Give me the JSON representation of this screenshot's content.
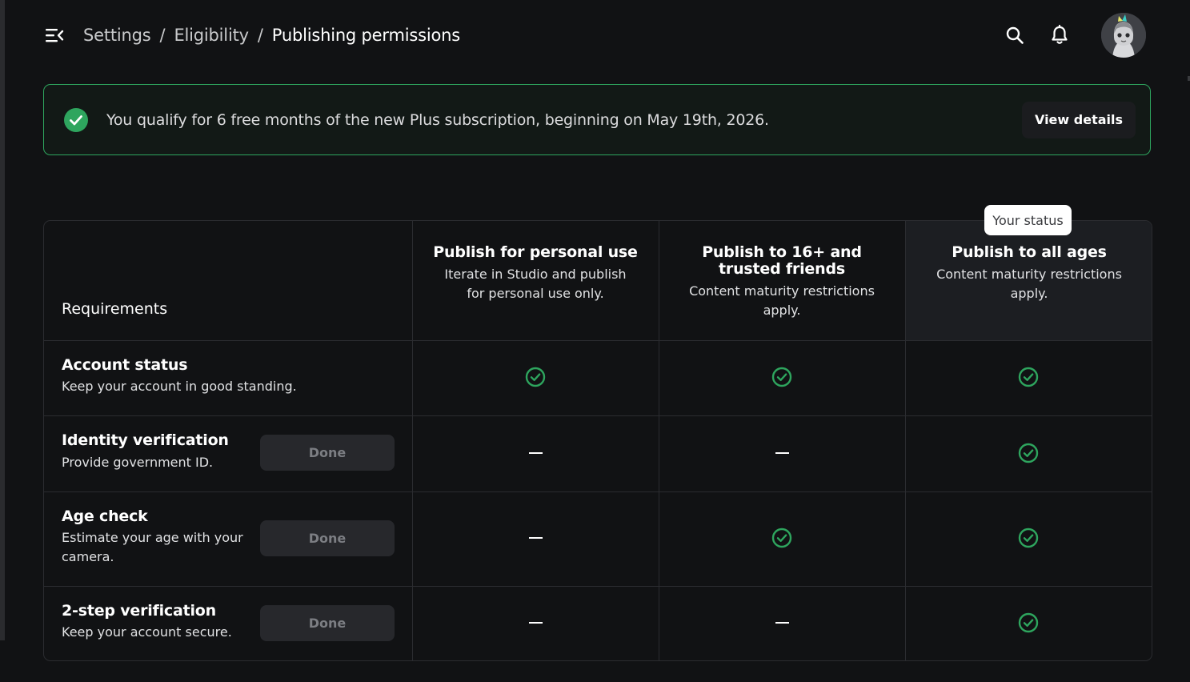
{
  "header": {
    "breadcrumb": [
      "Settings",
      "Eligibility",
      "Publishing permissions"
    ],
    "separator": "/"
  },
  "banner": {
    "message": "You qualify for 6 free months of the new Plus subscription, beginning on May 19th, 2026.",
    "action_label": "View details",
    "accent_color": "#2ea55e"
  },
  "table": {
    "requirements_label": "Requirements",
    "status_tooltip": "Your status",
    "columns": [
      {
        "title": "Publish for personal use",
        "description": "Iterate in Studio and publish for personal use only."
      },
      {
        "title": "Publish to 16+ and trusted friends",
        "description": "Content maturity restrictions apply."
      },
      {
        "title": "Publish to all ages",
        "description": "Content maturity restrictions apply.",
        "current": true
      }
    ],
    "rows": [
      {
        "title": "Account status",
        "description": "Keep your account in good standing.",
        "button": null,
        "cells": [
          "check",
          "check",
          "check"
        ]
      },
      {
        "title": "Identity verification",
        "description": "Provide government ID.",
        "button": "Done",
        "cells": [
          "dash",
          "dash",
          "check"
        ]
      },
      {
        "title": "Age check",
        "description": "Estimate your age with your camera.",
        "button": "Done",
        "cells": [
          "dash",
          "check",
          "check"
        ]
      },
      {
        "title": "2-step verification",
        "description": "Keep your account secure.",
        "button": "Done",
        "cells": [
          "dash",
          "dash",
          "check"
        ]
      }
    ]
  },
  "colors": {
    "background": "#111214",
    "success": "#2ea55e",
    "highlight_column": "#1c1e22"
  },
  "icons": {
    "menu": "menu-collapse-icon",
    "search": "search-icon",
    "notifications": "bell-icon",
    "check": "check-circle-icon",
    "not_required": "dash-icon"
  }
}
